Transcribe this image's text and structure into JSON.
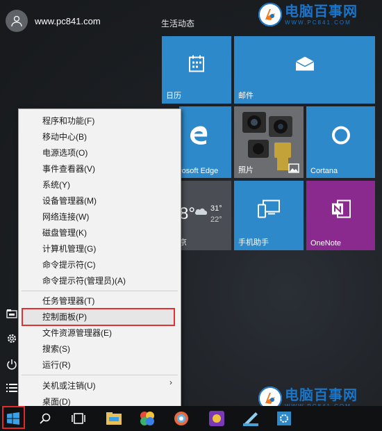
{
  "user": {
    "name": "www.pc841.com"
  },
  "group_title": "生活动态",
  "watermark": {
    "title": "电脑百事网",
    "url": "WWW.PC841.COM"
  },
  "tiles": {
    "calendar": "日历",
    "mail": "邮件",
    "edge": "rosoft Edge",
    "photos": "照片",
    "cortana": "Cortana",
    "weather_temp": "8°",
    "weather_high": "31°",
    "weather_low": "22°",
    "weather_city": "京",
    "phone": "手机助手",
    "onenote": "OneNote"
  },
  "menu": {
    "items": [
      "程序和功能(F)",
      "移动中心(B)",
      "电源选项(O)",
      "事件查看器(V)",
      "系统(Y)",
      "设备管理器(M)",
      "网络连接(W)",
      "磁盘管理(K)",
      "计算机管理(G)",
      "命令提示符(C)",
      "命令提示符(管理员)(A)",
      "任务管理器(T)",
      "控制面板(P)",
      "文件资源管理器(E)",
      "搜索(S)",
      "运行(R)",
      "关机或注销(U)",
      "桌面(D)"
    ],
    "submenu_arrow": "›"
  },
  "colors": {
    "tile_blue": "#2d89ca",
    "tile_purple": "#8a2a8f",
    "highlight_border": "#e03030"
  }
}
